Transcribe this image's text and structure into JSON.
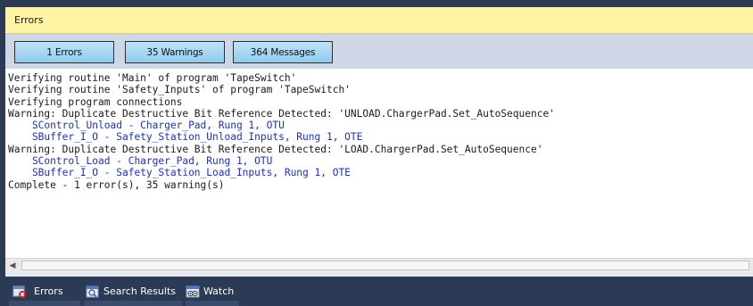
{
  "window": {
    "title": "Errors"
  },
  "filters": {
    "errors_label": "1 Errors",
    "warnings_label": "35 Warnings",
    "messages_label": "364 Messages"
  },
  "output": {
    "lines": [
      {
        "text": "Verifying routine 'Main' of program 'TapeSwitch'",
        "style": "normal"
      },
      {
        "text": "Verifying routine 'Safety_Inputs' of program 'TapeSwitch'",
        "style": "normal"
      },
      {
        "text": "Verifying program connections",
        "style": "normal"
      },
      {
        "text": "Warning: Duplicate Destructive Bit Reference Detected: 'UNLOAD.ChargerPad.Set_AutoSequence'",
        "style": "normal"
      },
      {
        "text": "    SControl_Unload - Charger_Pad, Rung 1, OTU",
        "style": "link"
      },
      {
        "text": "    SBuffer_I_O - Safety_Station_Unload_Inputs, Rung 1, OTE",
        "style": "link"
      },
      {
        "text": "Warning: Duplicate Destructive Bit Reference Detected: 'LOAD.ChargerPad.Set_AutoSequence'",
        "style": "normal"
      },
      {
        "text": "    SControl_Load - Charger_Pad, Rung 1, OTU",
        "style": "link"
      },
      {
        "text": "    SBuffer_I_O - Safety_Station_Load_Inputs, Rung 1, OTE",
        "style": "link"
      },
      {
        "text": "Complete - 1 error(s), 35 warning(s)",
        "style": "normal"
      }
    ]
  },
  "tabs": [
    {
      "label": "Errors",
      "icon": "errors-icon"
    },
    {
      "label": "Search Results",
      "icon": "search-results-icon"
    },
    {
      "label": "Watch",
      "icon": "watch-icon"
    }
  ],
  "colors": {
    "title_bg": "#fff4a3",
    "link_text": "#1c2fc8",
    "panel_bg": "#2b3a55"
  }
}
